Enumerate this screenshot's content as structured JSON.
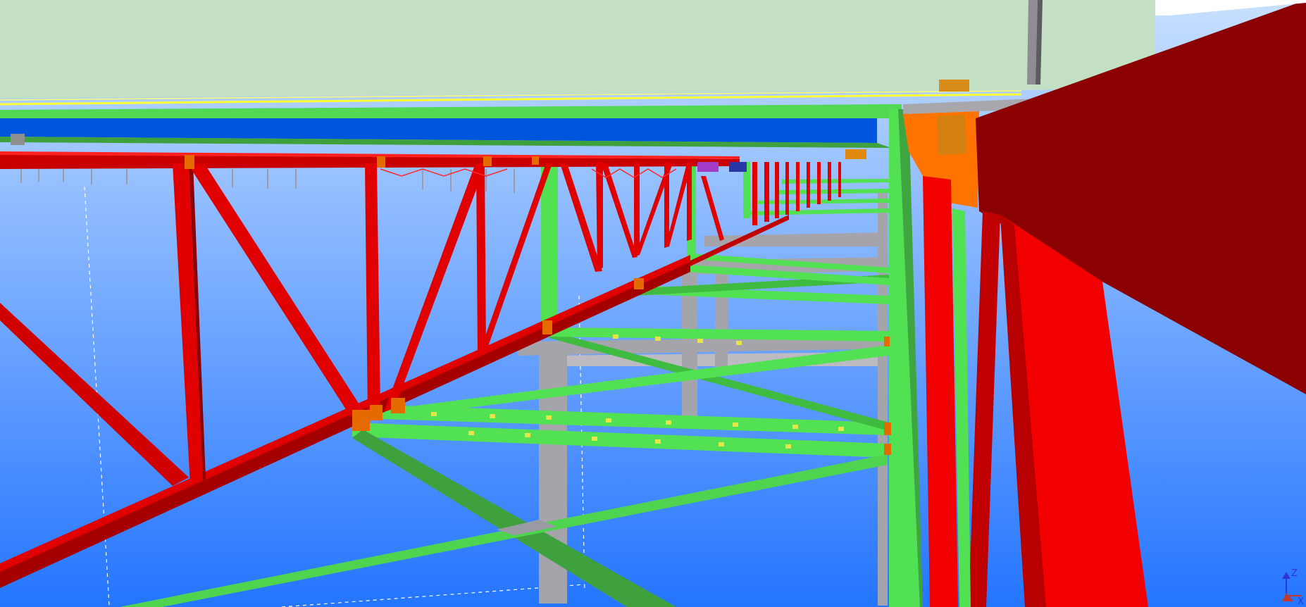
{
  "viewport": {
    "background_top": "#bcd9ff",
    "background_bottom": "#2f7fff",
    "slab_color": "#c3dfc4",
    "edge_highlight": "#ffff33",
    "deck_beam_color": "#0055dd"
  },
  "members": {
    "truss_color": "#f20000",
    "truss_dark": "#9b0000",
    "bracing_color": "#4ee84e",
    "bracing_dark": "#2fa32f",
    "column_color": "#a7a4ab",
    "connection_plate_color": "#e56a00",
    "bolt_color": "#d98c1a",
    "girder_color": "#8b0000"
  },
  "axis_triad": {
    "z_label": "Z",
    "x_label": "X",
    "icon": "axis-triad-icon"
  }
}
